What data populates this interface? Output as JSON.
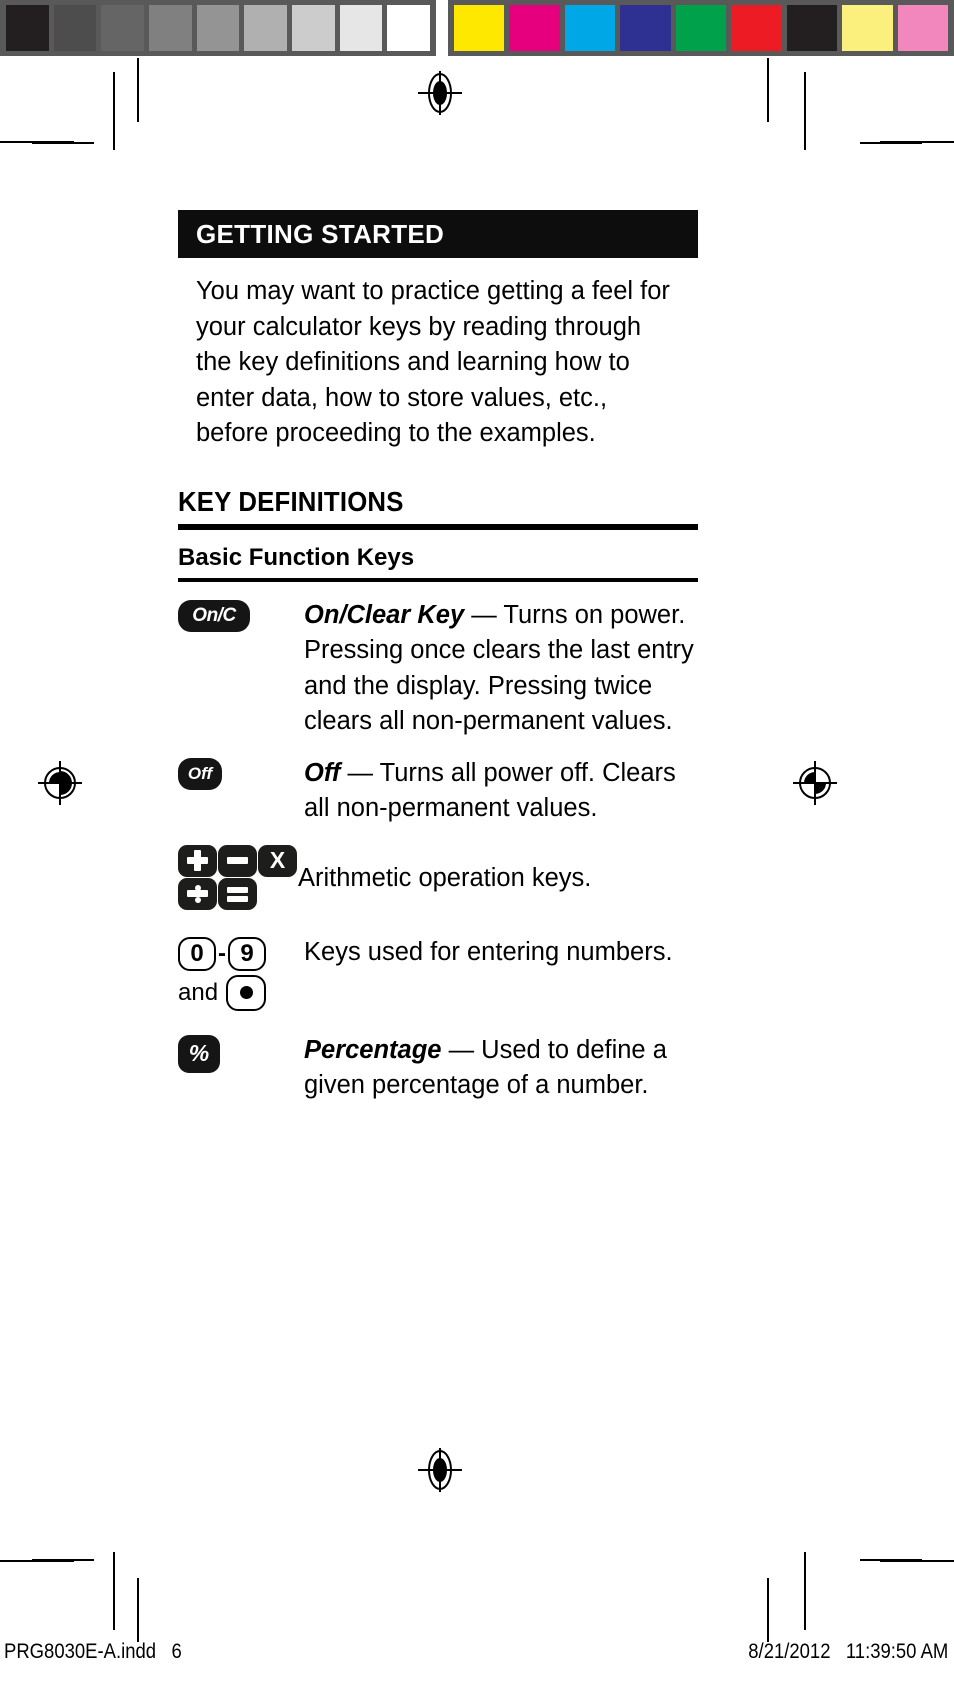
{
  "prepress": {
    "gray_swatches": [
      "#231f20",
      "#4d4d4d",
      "#656565",
      "#808080",
      "#949494",
      "#b0b0b0",
      "#cccccc",
      "#e6e6e6",
      "#ffffff"
    ],
    "color_swatches": [
      "#ffe800",
      "#e6007e",
      "#00a7e7",
      "#2e3192",
      "#00a14b",
      "#ed1c24",
      "#231f20",
      "#fbf07d",
      "#f287bd"
    ],
    "registration_marks": [
      "top-center",
      "left-middle",
      "right-middle",
      "bottom-center"
    ]
  },
  "page": {
    "section_banner": "GETTING STARTED",
    "intro_paragraph": "You may want to practice getting a feel for your calculator keys by reading through the key definitions and learning how to enter data, how to store values, etc., before proceeding to the examples.",
    "heading_key_definitions": "KEY DEFINITIONS",
    "subheading_basic_function_keys": "Basic Function Keys"
  },
  "key_rows": [
    {
      "key_label": "On/C",
      "key_icon": "on-clear-key",
      "term": "On/Clear Key",
      "dash": " — ",
      "description": "Turns on power. Pressing once clears the last entry and the display. Pressing twice clears all non-permanent values."
    },
    {
      "key_label": "Off",
      "key_icon": "off-key",
      "term": "Off",
      "dash": " — ",
      "description": "Turns all power off. Clears all non-permanent values."
    },
    {
      "key_label": "+ − X ÷ =",
      "key_icon": "arithmetic-keys",
      "term": "",
      "dash": "",
      "description": "Arithmetic operation keys."
    },
    {
      "key_label": "0-9 and .",
      "key_icon": "number-keys",
      "term": "",
      "dash": "",
      "description": "Keys used for entering numbers."
    },
    {
      "key_label": "%",
      "key_icon": "percent-key",
      "term": "Percentage",
      "dash": " — ",
      "description": "Used to define a given percentage of a number."
    }
  ],
  "arithmetic_keys": {
    "row1": [
      "plus-icon",
      "minus-icon",
      "multiply-icon"
    ],
    "row2": [
      "divide-icon",
      "equals-icon"
    ],
    "multiply_glyph": "X"
  },
  "number_keys": {
    "first": "0",
    "separator": "-",
    "last": "9",
    "and_word": "and",
    "decimal_glyph": "●"
  },
  "percent_key_label": "%",
  "footer": {
    "file_name": "PRG8030E-A.indd   6",
    "timestamp": "8/21/2012   11:39:50 AM"
  }
}
